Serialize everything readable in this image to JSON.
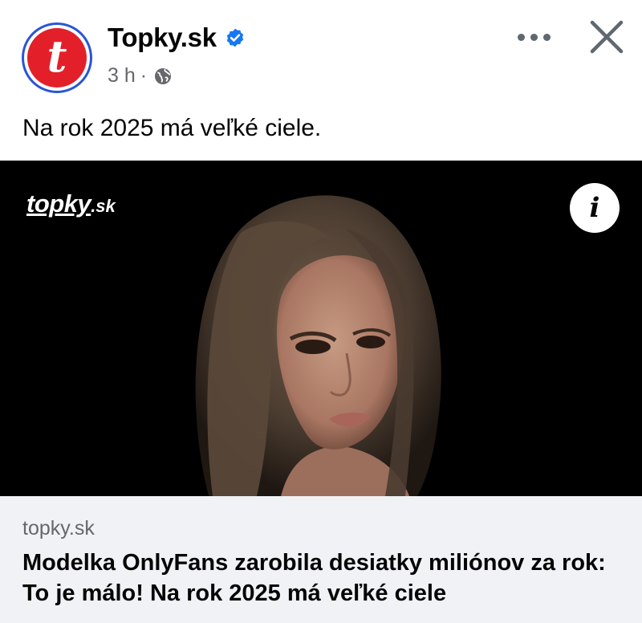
{
  "post": {
    "page_name": "Topky.sk",
    "avatar_letter": "t",
    "timestamp": "3 h",
    "separator": "·",
    "visibility_icon": "globe-icon",
    "verified_icon": "verified-badge-icon",
    "caption": "Na rok 2025 má veľké ciele."
  },
  "media": {
    "watermark_main": "topky",
    "watermark_tld": ".sk",
    "info_label": "i"
  },
  "link_preview": {
    "domain": "topky.sk",
    "title": "Modelka OnlyFans zarobila desiatky miliónov za rok: To je málo! Na rok 2025 má veľké ciele"
  },
  "colors": {
    "brand_red": "#e3202a",
    "verified_blue": "#1877f2",
    "muted_text": "#65676b",
    "link_bg": "#f0f2f5"
  }
}
